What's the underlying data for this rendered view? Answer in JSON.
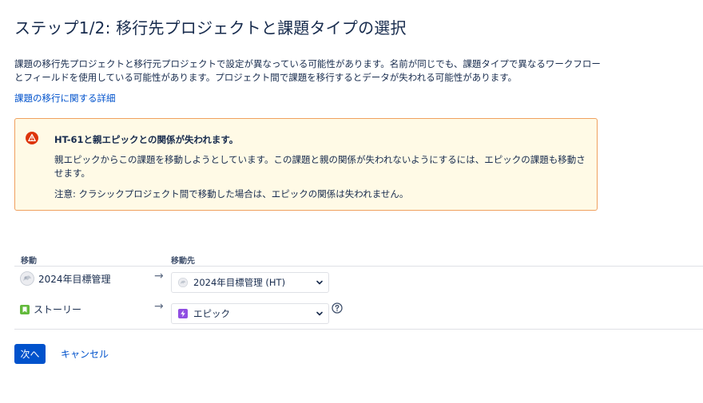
{
  "page": {
    "title": "ステップ1/2: 移行先プロジェクトと課題タイプの選択",
    "description": "課題の移行先プロジェクトと移行元プロジェクトで設定が異なっている可能性があります。名前が同じでも、課題タイプで異なるワークフローとフィールドを使用している可能性があります。プロジェクト間で課題を移行するとデータが失われる可能性があります。",
    "detail_link": "課題の移行に関する詳細"
  },
  "warning": {
    "icon": "warning-icon",
    "title": "HT-61と親エピックとの関係が失われます。",
    "body": "親エピックからこの課題を移動しようとしています。この課題と親の関係が失われないようにするには、エピックの課題も移動させます。",
    "note": "注意: クラシックプロジェクト間で移動した場合は、エピックの関係は失われません。",
    "colors": {
      "background": "#fffae6",
      "border": "#f0a05e",
      "icon": "#de350b"
    }
  },
  "move_table": {
    "header_from": "移動",
    "header_to": "移動先",
    "rows": [
      {
        "from_label": "2024年目標管理",
        "from_icon": "project-avatar-icon",
        "to_value": "2024年目標管理 (HT)",
        "to_icon": "project-avatar-icon"
      },
      {
        "from_label": "ストーリー",
        "from_icon": "story-icon",
        "to_value": "エピック",
        "to_icon": "epic-icon"
      }
    ]
  },
  "buttons": {
    "next": "次へ",
    "cancel": "キャンセル"
  },
  "colors": {
    "primary": "#0052cc",
    "story": "#63ba3c",
    "epic": "#904ee2",
    "text": "#172b4d"
  }
}
